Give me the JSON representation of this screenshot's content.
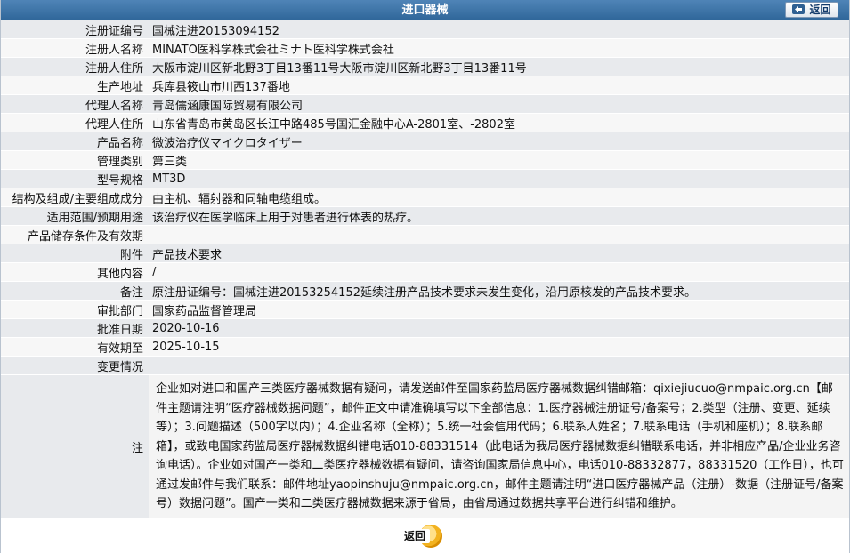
{
  "header": {
    "title": "进口器械",
    "back_label": "返回"
  },
  "rows": [
    {
      "label": "注册证编号",
      "value": "国械注进20153094152"
    },
    {
      "label": "注册人名称",
      "value": "MINATO医科学株式会社ミナト医科学株式会社"
    },
    {
      "label": "注册人住所",
      "value": "大阪市淀川区新北野3丁目13番11号大阪市淀川区新北野3丁目13番11号"
    },
    {
      "label": "生产地址",
      "value": "兵库县筱山市川西137番地"
    },
    {
      "label": "代理人名称",
      "value": "青岛儒涵康国际贸易有限公司"
    },
    {
      "label": "代理人住所",
      "value": "山东省青岛市黄岛区长江中路485号国汇金融中心A-2801室、-2802室"
    },
    {
      "label": "产品名称",
      "value": "微波治疗仪マイクロタイザー"
    },
    {
      "label": "管理类别",
      "value": "第三类"
    },
    {
      "label": "型号规格",
      "value": "MT3D"
    },
    {
      "label": "结构及组成/主要组成成分",
      "value": "由主机、辐射器和同轴电缆组成。"
    },
    {
      "label": "适用范围/预期用途",
      "value": "该治疗仪在医学临床上用于对患者进行体表的热疗。"
    },
    {
      "label": "产品储存条件及有效期",
      "value": ""
    },
    {
      "label": "附件",
      "value": "产品技术要求"
    },
    {
      "label": "其他内容",
      "value": "/"
    },
    {
      "label": "备注",
      "value": "原注册证编号：国械注进20153254152延续注册产品技术要求未发生变化，沿用原核发的产品技术要求。"
    },
    {
      "label": "审批部门",
      "value": "国家药品监督管理局"
    },
    {
      "label": "批准日期",
      "value": "2020-10-16"
    },
    {
      "label": "有效期至",
      "value": "2025-10-15"
    },
    {
      "label": "变更情况",
      "value": ""
    }
  ],
  "note": {
    "label": "注",
    "text": "企业如对进口和国产三类医疗器械数据有疑问，请发送邮件至国家药监局医疗器械数据纠错邮箱：qixiejiucuo@nmpaic.org.cn【邮件主题请注明“医疗器械数据问题”，邮件正文中请准确填写以下全部信息：1.医疗器械注册证号/备案号；2.类型（注册、变更、延续等）；3.问题描述（500字以内）；4.企业名称（全称）；5.统一社会信用代码；6.联系人姓名；7.联系电话（手机和座机）；8.联系邮箱】，或致电国家药监局医疗器械数据纠错电话010-88331514（此电话为我局医疗器械数据纠错联系电话，并非相应产品/企业业务咨询电话）。企业如对国产一类和二类医疗器械数据有疑问，请咨询国家局信息中心，电话010-88332877，88331520（工作日），也可通过发邮件与我们联系：邮件地址yaopinshuju@nmpaic.org.cn，邮件主题请注明“进口医疗器械产品（注册）-数据（注册证号/备案号）数据问题”。国产一类和二类医疗器械数据来源于省局，由省局通过数据共享平台进行纠错和维护。"
  },
  "footer": {
    "back_label": "返回"
  },
  "colors": {
    "header_bg": "#2f6699",
    "row_odd": "#e8eaed",
    "row_even": "#f7f7f7",
    "button_orange": "#f2b21f"
  }
}
